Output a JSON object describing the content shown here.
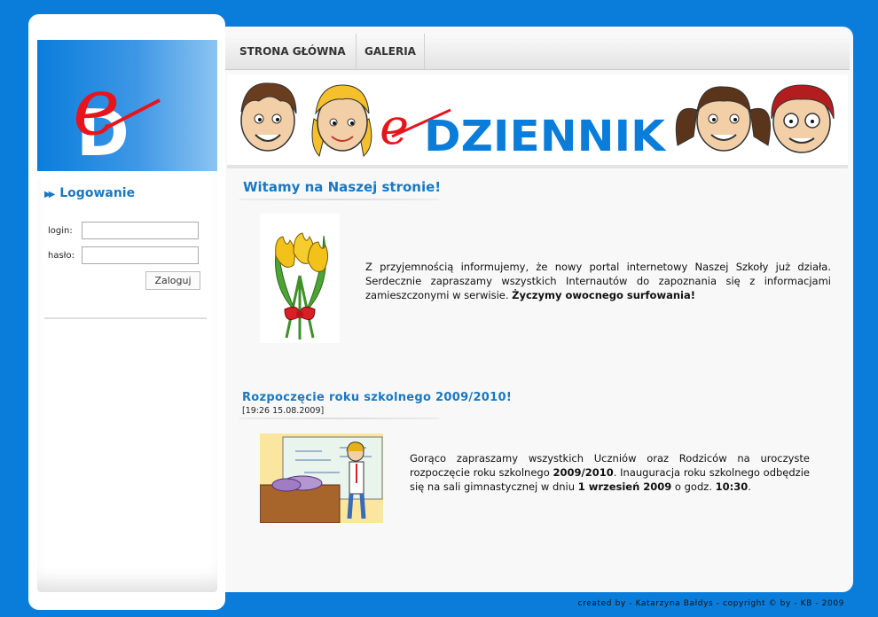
{
  "nav": {
    "home_label": "STRONA GŁÓWNA",
    "gallery_label": "GALERIA"
  },
  "banner": {
    "logo_letter": "e",
    "title": "DZIENNIK"
  },
  "logo": {
    "letter_e": "e",
    "letter_d": "D"
  },
  "login": {
    "title": "Logowanie",
    "login_label": "login:",
    "password_label": "hasło:",
    "login_value": "",
    "password_value": "",
    "submit_label": "Zaloguj"
  },
  "main": {
    "welcome_title": "Witamy na Naszej stronie!",
    "welcome_text": "Z przyjemnością informujemy, że nowy portal internetowy Naszej Szkoły już działa. Serdecznie zapraszamy wszystkich Internautów do zapoznania się z informacjami zamieszczonymi w serwisie.",
    "welcome_bold": "Życzymy owocnego surfowania!",
    "news": {
      "title": "Rozpoczęcie roku szkolnego 2009/2010!",
      "date": "[19:26 15.08.2009]",
      "text_1": "Gorąco zapraszamy wszystkich Uczniów oraz Rodziców na uroczyste rozpoczęcie roku szkolnego ",
      "bold_1": "2009/2010",
      "text_2": ". Inauguracja roku szkolnego odbędzie się na sali gimnastycznej w dniu ",
      "bold_2": "1 wrzesień 2009",
      "text_3": " o godz. ",
      "bold_3": "10:30",
      "text_4": "."
    }
  },
  "footer": {
    "text": "created by - Katarzyna Bałdys - copyright © by - KB - 2009"
  },
  "colors": {
    "page_bg": "#0a7ddb",
    "accent_blue": "#1a78c2",
    "logo_red": "#e8141c"
  }
}
